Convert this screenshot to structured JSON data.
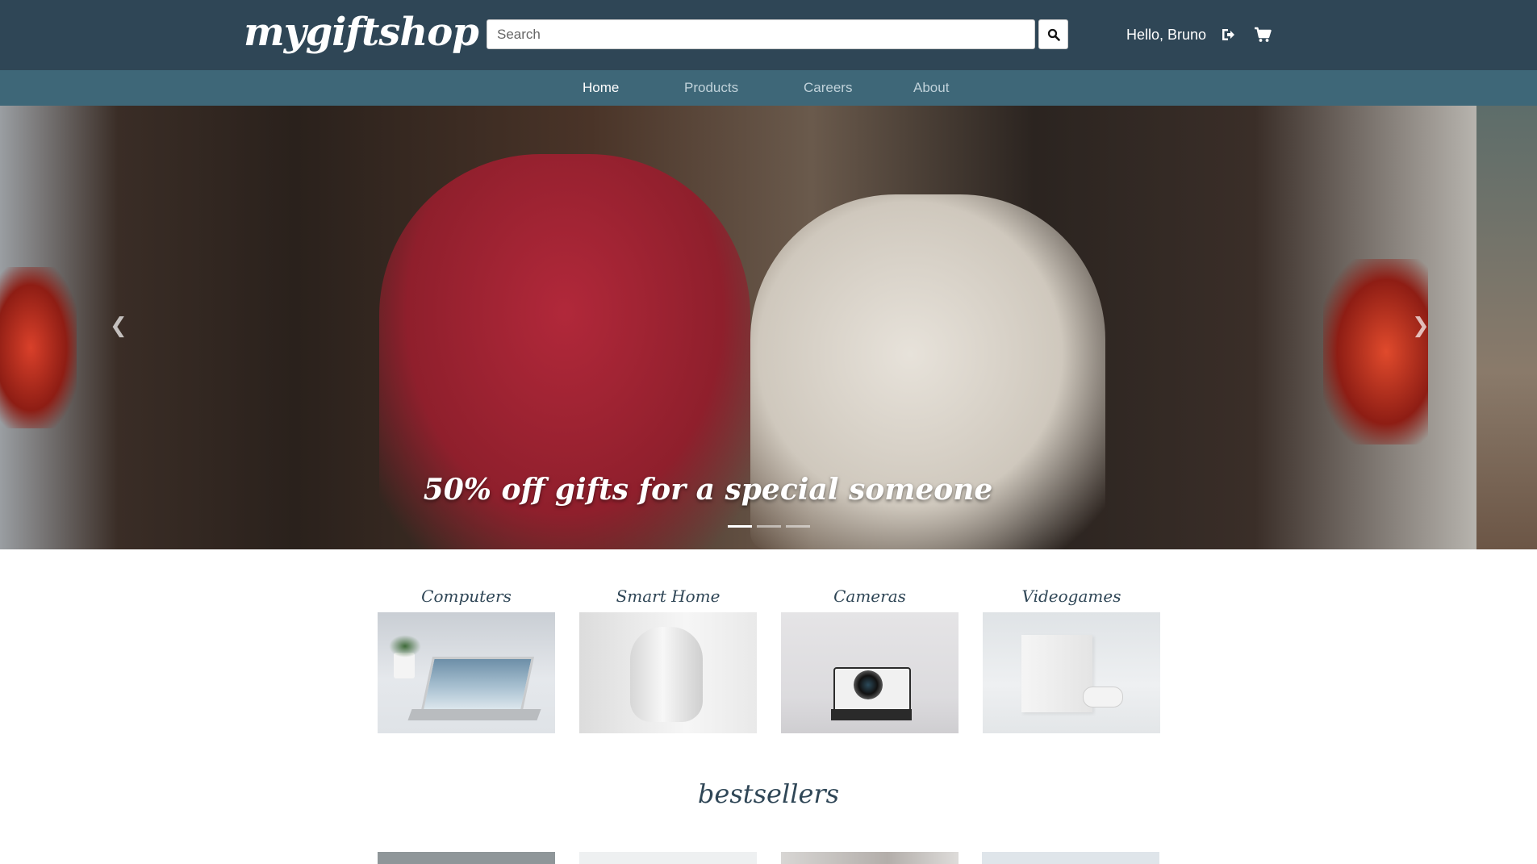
{
  "header": {
    "logo": "mygiftshop",
    "search_placeholder": "Search",
    "greeting": "Hello, Bruno",
    "icons": {
      "search": "search-icon",
      "logout": "sign-out-icon",
      "cart": "shopping-cart-icon"
    }
  },
  "nav": {
    "items": [
      {
        "label": "Home",
        "active": true
      },
      {
        "label": "Products",
        "active": false
      },
      {
        "label": "Careers",
        "active": false
      },
      {
        "label": "About",
        "active": false
      }
    ]
  },
  "hero": {
    "caption": "50% off gifts for a special someone",
    "prev_icon": "chevron-left-icon",
    "next_icon": "chevron-right-icon",
    "slides_count": 3,
    "active_slide": 1
  },
  "categories": [
    {
      "title": "Computers"
    },
    {
      "title": "Smart Home"
    },
    {
      "title": "Cameras"
    },
    {
      "title": "Videogames"
    }
  ],
  "bestsellers": {
    "title": "bestsellers"
  },
  "colors": {
    "header_bg": "#2f4656",
    "nav_bg": "#3e6778",
    "accent_text": "#2f4656"
  }
}
